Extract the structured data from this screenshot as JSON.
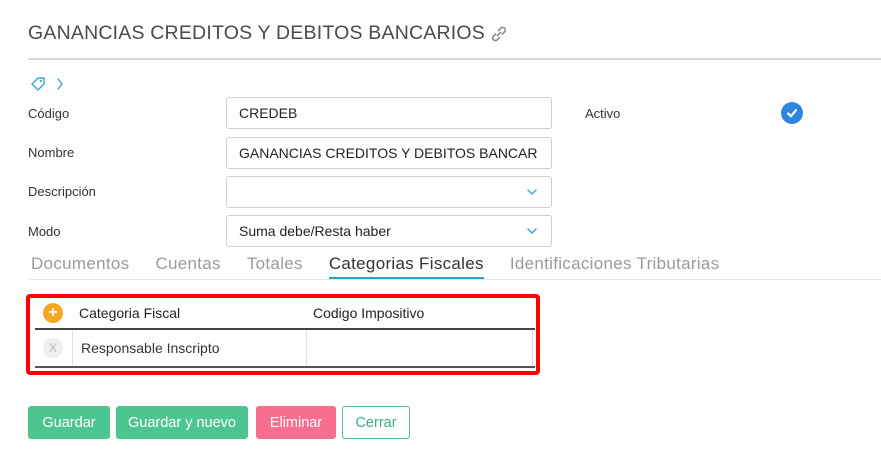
{
  "page": {
    "title": "GANANCIAS CREDITOS Y DEBITOS BANCARIOS"
  },
  "icons": {
    "title_link": "link-icon",
    "tag": "tag-icon",
    "chevron": "chevron-right-icon",
    "active_check": "check-circle-icon"
  },
  "form": {
    "codigo": {
      "label": "Código",
      "value": "CREDEB"
    },
    "nombre": {
      "label": "Nombre",
      "value": "GANANCIAS CREDITOS Y DEBITOS BANCAR"
    },
    "descripcion": {
      "label": "Descripción",
      "value": ""
    },
    "modo": {
      "label": "Modo",
      "value": "Suma debe/Resta haber"
    },
    "activo": {
      "label": "Activo",
      "checked": true
    }
  },
  "tabs": [
    {
      "label": "Documentos"
    },
    {
      "label": "Cuentas"
    },
    {
      "label": "Totales"
    },
    {
      "label": "Categorias Fiscales",
      "active": true
    },
    {
      "label": "Identificaciones Tributarias"
    }
  ],
  "grid": {
    "add_symbol": "+",
    "columns": [
      "Categoria Fiscal",
      "Codigo Impositivo"
    ],
    "rows": [
      {
        "remove_symbol": "X",
        "categoria": "Responsable Inscripto",
        "codigo": ""
      }
    ]
  },
  "buttons": {
    "guardar": "Guardar",
    "guardar_nuevo": "Guardar y nuevo",
    "eliminar": "Eliminar",
    "cerrar": "Cerrar"
  },
  "colors": {
    "primary_green": "#4dc58f",
    "danger_pink": "#f76e8f",
    "active_blue": "#2e86de",
    "tab_underline": "#2aa3c4",
    "add_orange": "#f5a623",
    "highlight_red": "#ff0000"
  }
}
